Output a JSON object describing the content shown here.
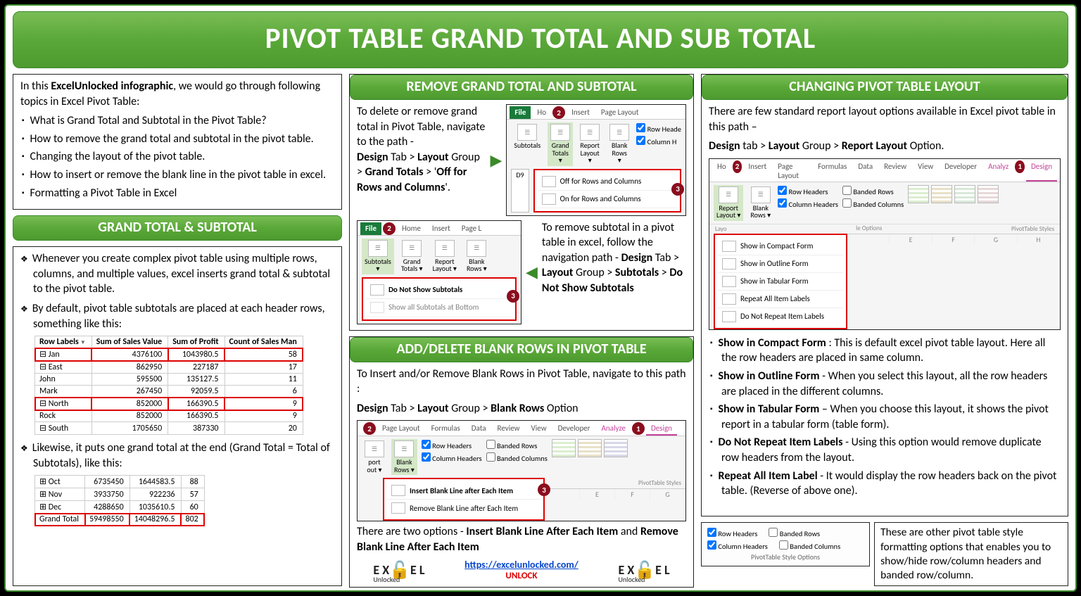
{
  "title": "PIVOT TABLE GRAND TOTAL AND SUB TOTAL",
  "intro": {
    "lead_pre": "In this ",
    "lead_bold": "ExcelUnlocked infographic",
    "lead_post": ", we would go through following topics in Excel Pivot Table:",
    "bullets": [
      "What is Grand Total and Subtotal in the Pivot Table?",
      "How to remove the grand total and subtotal in the pivot table.",
      "Changing the layout of the pivot table.",
      "How to insert or remove the blank line in the pivot table in excel.",
      "Formatting a Pivot Table in Excel"
    ]
  },
  "gtst": {
    "header": "GRAND TOTAL & SUBTOTAL",
    "b1": "Whenever you create complex pivot table using multiple rows, columns, and multiple values, excel inserts grand total & subtotal to the pivot table.",
    "b2": "By default, pivot table subtotals are placed at each header rows, something like this:",
    "b3": "Likewise, it puts one grand total at the end (Grand Total = Total of Subtotals), like this:",
    "tbl1_headers": [
      "Row Labels",
      "Sum of Sales Value",
      "Sum of Profit",
      "Count of Sales Man"
    ],
    "tbl1_rows": [
      {
        "cells": [
          "⊟ Jan",
          "4376100",
          "1043980.5",
          "58"
        ],
        "red": true,
        "bold": true
      },
      {
        "cells": [
          "  ⊟ East",
          "862950",
          "227187",
          "17"
        ],
        "red": false,
        "bold": true
      },
      {
        "cells": [
          "      John",
          "595500",
          "135127.5",
          "11"
        ],
        "red": false
      },
      {
        "cells": [
          "      Mark",
          "267450",
          "92059.5",
          "6"
        ],
        "red": false
      },
      {
        "cells": [
          "  ⊟ North",
          "852000",
          "166390.5",
          "9"
        ],
        "red": true,
        "bold": true
      },
      {
        "cells": [
          "      Rock",
          "852000",
          "166390.5",
          "9"
        ],
        "red": false
      },
      {
        "cells": [
          "  ⊟ South",
          "1705650",
          "387330",
          "20"
        ],
        "red": false,
        "bold": true
      }
    ],
    "tbl2_rows": [
      {
        "cells": [
          "⊞ Oct",
          "6735450",
          "1644583.5",
          "88"
        ]
      },
      {
        "cells": [
          "⊞ Nov",
          "3933750",
          "922236",
          "57"
        ]
      },
      {
        "cells": [
          "⊞ Dec",
          "4288650",
          "1035610.5",
          "60"
        ]
      },
      {
        "cells": [
          "Grand Total",
          "59498550",
          "14048296.5",
          "802"
        ],
        "red": true,
        "bold": true
      }
    ]
  },
  "remove": {
    "header": "REMOVE GRAND TOTAL AND SUBTOTAL",
    "gt_text_pre": "To delete or remove grand total in Pivot Table, navigate to the path - ",
    "gt_path": "Design Tab > Layout Group > Grand Totals > 'Off for Rows and Columns'.",
    "st_text_pre": "To remove subtotal in a pivot table in excel, follow the navigation path - ",
    "st_path": "Design Tab > Layout Group > Subtotals > Do Not Show Subtotals",
    "rib1_tabs": [
      "File",
      "Ho",
      "",
      "Insert",
      "Page Layout"
    ],
    "rib1_btns": [
      "Subtotals",
      "Grand Totals",
      "Report Layout",
      "Blank Rows"
    ],
    "rib1_chks": [
      "Row Heade",
      "Column H"
    ],
    "rib1_menu": [
      "Off for Rows and Columns",
      "On for Rows and Columns"
    ],
    "rib1_cell": "D9",
    "rib2_tabs": [
      "File",
      "",
      "Home",
      "Insert",
      "Page L"
    ],
    "rib2_btns": [
      "Subtotals",
      "Grand Totals",
      "Report Layout",
      "Blank Rows"
    ],
    "rib2_menu": [
      "Do Not Show Subtotals",
      "Show all Subtotals at Bottom"
    ]
  },
  "blank": {
    "header": "ADD/DELETE BLANK ROWS IN PIVOT TABLE",
    "intro": "To Insert and/or Remove Blank Rows in Pivot Table, navigate to this path :",
    "path": "Design Tab > Layout Group > Blank Rows Option",
    "rib_tabs": [
      "",
      "Page Layout",
      "Formulas",
      "Data",
      "Review",
      "View",
      "Developer",
      "Analyze",
      "Design"
    ],
    "rib_btns": [
      "port out",
      "Blank Rows"
    ],
    "rib_chks": [
      "Row Headers",
      "Banded Rows",
      "Column Headers",
      "Banded Columns"
    ],
    "menu": [
      "Insert Blank Line after Each Item",
      "Remove Blank Line after Each Item"
    ],
    "cols": [
      "",
      "E",
      "F",
      "G"
    ],
    "note_pre": "There are two options - ",
    "note_b1": "Insert Blank Line After Each Item",
    "note_mid": " and ",
    "note_b2": "Remove Blank Line After Each Item",
    "pts": "PivotTable Styles"
  },
  "layout": {
    "header": "CHANGING PIVOT TABLE LAYOUT",
    "intro": "There are few standard report layout options available in Excel pivot table in this path –",
    "path": "Design tab > Layout Group > Report Layout Option.",
    "rib_tabs": [
      "Ho",
      "Insert",
      "Page Layout",
      "Formulas",
      "Data",
      "Review",
      "View",
      "Developer",
      "Analyz",
      "Design"
    ],
    "btns": [
      "Report Layout",
      "Blank Rows"
    ],
    "chks": [
      "Row Headers",
      "Banded Rows",
      "Column Headers",
      "Banded Columns"
    ],
    "menu": [
      "Show in Compact Form",
      "Show in Outline Form",
      "Show in Tabular Form",
      "Repeat All Item Labels",
      "Do Not Repeat Item Labels"
    ],
    "cols": [
      "",
      "E",
      "F",
      "G",
      "H"
    ],
    "grp1": "Layo",
    "grp2": "le Options",
    "grp3": "PivotTable Styles",
    "bullets": [
      {
        "b": "Show in Compact Form",
        "t": " : This is default excel pivot table layout. Here all the row headers are placed in same column."
      },
      {
        "b": "Show in Outline Form",
        "t": " - When you select this layout, all the row headers are placed in the different columns."
      },
      {
        "b": "Show in Tabular Form",
        "t": " – When you choose this layout, it shows the pivot report in a tabular form (table form)."
      },
      {
        "b": "Do Not Repeat Item Labels",
        "t": " - Using this option would remove duplicate row headers from the layout."
      },
      {
        "b": "Repeat All Item Label",
        "t": " - It would display the row headers back on the pivot table. (Reverse of above one)."
      }
    ]
  },
  "style": {
    "chks": [
      "Row Headers",
      "Banded Rows",
      "Column Headers",
      "Banded Columns"
    ],
    "caption": "PivotTable Style Options",
    "note": "These are other pivot table style formatting options that enables you to show/hide row/column headers and banded row/column."
  },
  "footer": {
    "logo": "EXCEL",
    "logo_sub": "Unlocked",
    "url": "https://excelunlocked.com/",
    "unlock": "UNLOCK"
  }
}
